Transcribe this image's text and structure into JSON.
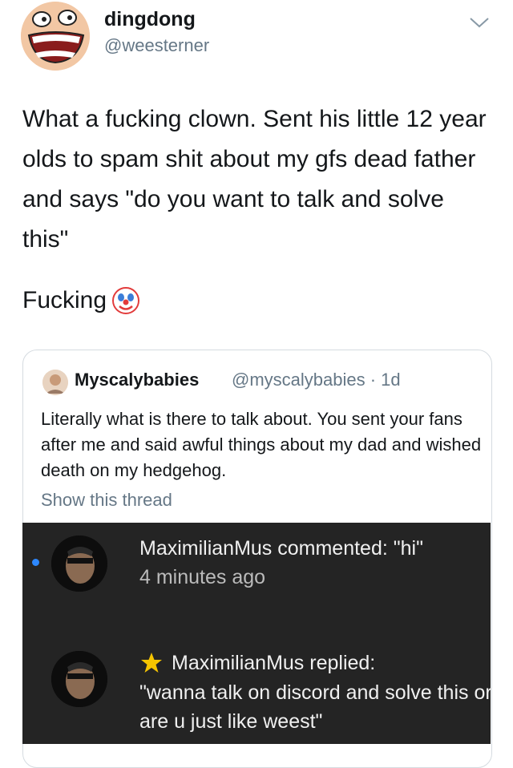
{
  "tweet": {
    "author_name": "dingdong",
    "author_handle": "@weesterner",
    "text": "What a fucking clown. Sent his little 12 year olds to spam shit about my gfs dead father and says \"do you want to talk and solve this\"",
    "second_line": "Fucking"
  },
  "quoted_tweet": {
    "author_name": "Myscalybabies",
    "author_meta": "@myscalybabies · 1d",
    "text": "Literally what is there to talk about. You sent your fans after me and said awful things about my dad and wished death on my hedgehog.",
    "show_thread_label": "Show this thread"
  },
  "notifications": [
    {
      "text": "MaximilianMus commented: \"hi\"",
      "time": "4 minutes ago"
    },
    {
      "text": "MaximilianMus replied:",
      "reply": "\"wanna talk on discord and solve this or are u just like weest\""
    }
  ],
  "icons": {
    "author_avatar": "smiling-face-icon",
    "clown": "clown-face-icon",
    "dropdown": "chevron-down-icon",
    "star": "star-icon"
  },
  "colors": {
    "link_gray": "#657786",
    "dark_panel": "#242424",
    "unread_dot": "#2d88ff",
    "star": "#f6c500"
  }
}
